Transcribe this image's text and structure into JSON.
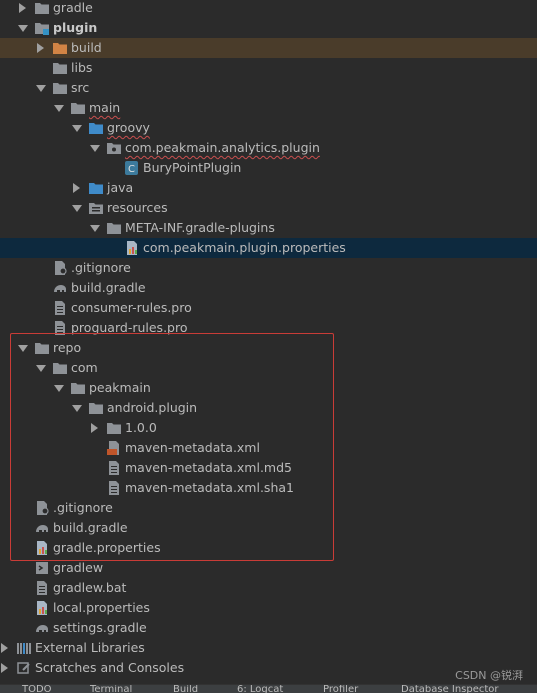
{
  "tree": {
    "gradle": "gradle",
    "plugin": "plugin",
    "build": "build",
    "libs": "libs",
    "src": "src",
    "main": "main",
    "groovy": "groovy",
    "pkg": "com.peakmain.analytics.plugin",
    "bury": "BuryPointPlugin",
    "java": "java",
    "resources": "resources",
    "metainf": "META-INF.gradle-plugins",
    "props": "com.peakmain.plugin.properties",
    "gitignore1": ".gitignore",
    "buildgradle1": "build.gradle",
    "consumer": "consumer-rules.pro",
    "proguard": "proguard-rules.pro",
    "repo": "repo",
    "com": "com",
    "peakmain": "peakmain",
    "androidplugin": "android.plugin",
    "v100": "1.0.0",
    "mavenxml": "maven-metadata.xml",
    "mavenmd5": "maven-metadata.xml.md5",
    "mavensha1": "maven-metadata.xml.sha1",
    "gitignore2": ".gitignore",
    "buildgradle2": "build.gradle",
    "gradleprops": "gradle.properties",
    "gradlew": "gradlew",
    "gradlewbat": "gradlew.bat",
    "localprops": "local.properties",
    "settings": "settings.gradle",
    "extlibs": "External Libraries",
    "scratches": "Scratches and Consoles"
  },
  "bottom_tabs": [
    "TODO",
    "Terminal",
    "Build",
    "6: Logcat",
    "Profiler",
    "Database Inspector"
  ],
  "watermark": "CSDN @锐湃",
  "colors": {
    "background": "#2b2b2b",
    "selected_build": "#4a3c2a",
    "selected_file": "#0d293e",
    "folder": "#8e9297",
    "orange_folder": "#d28445",
    "highlight_box": "#c93c37"
  }
}
